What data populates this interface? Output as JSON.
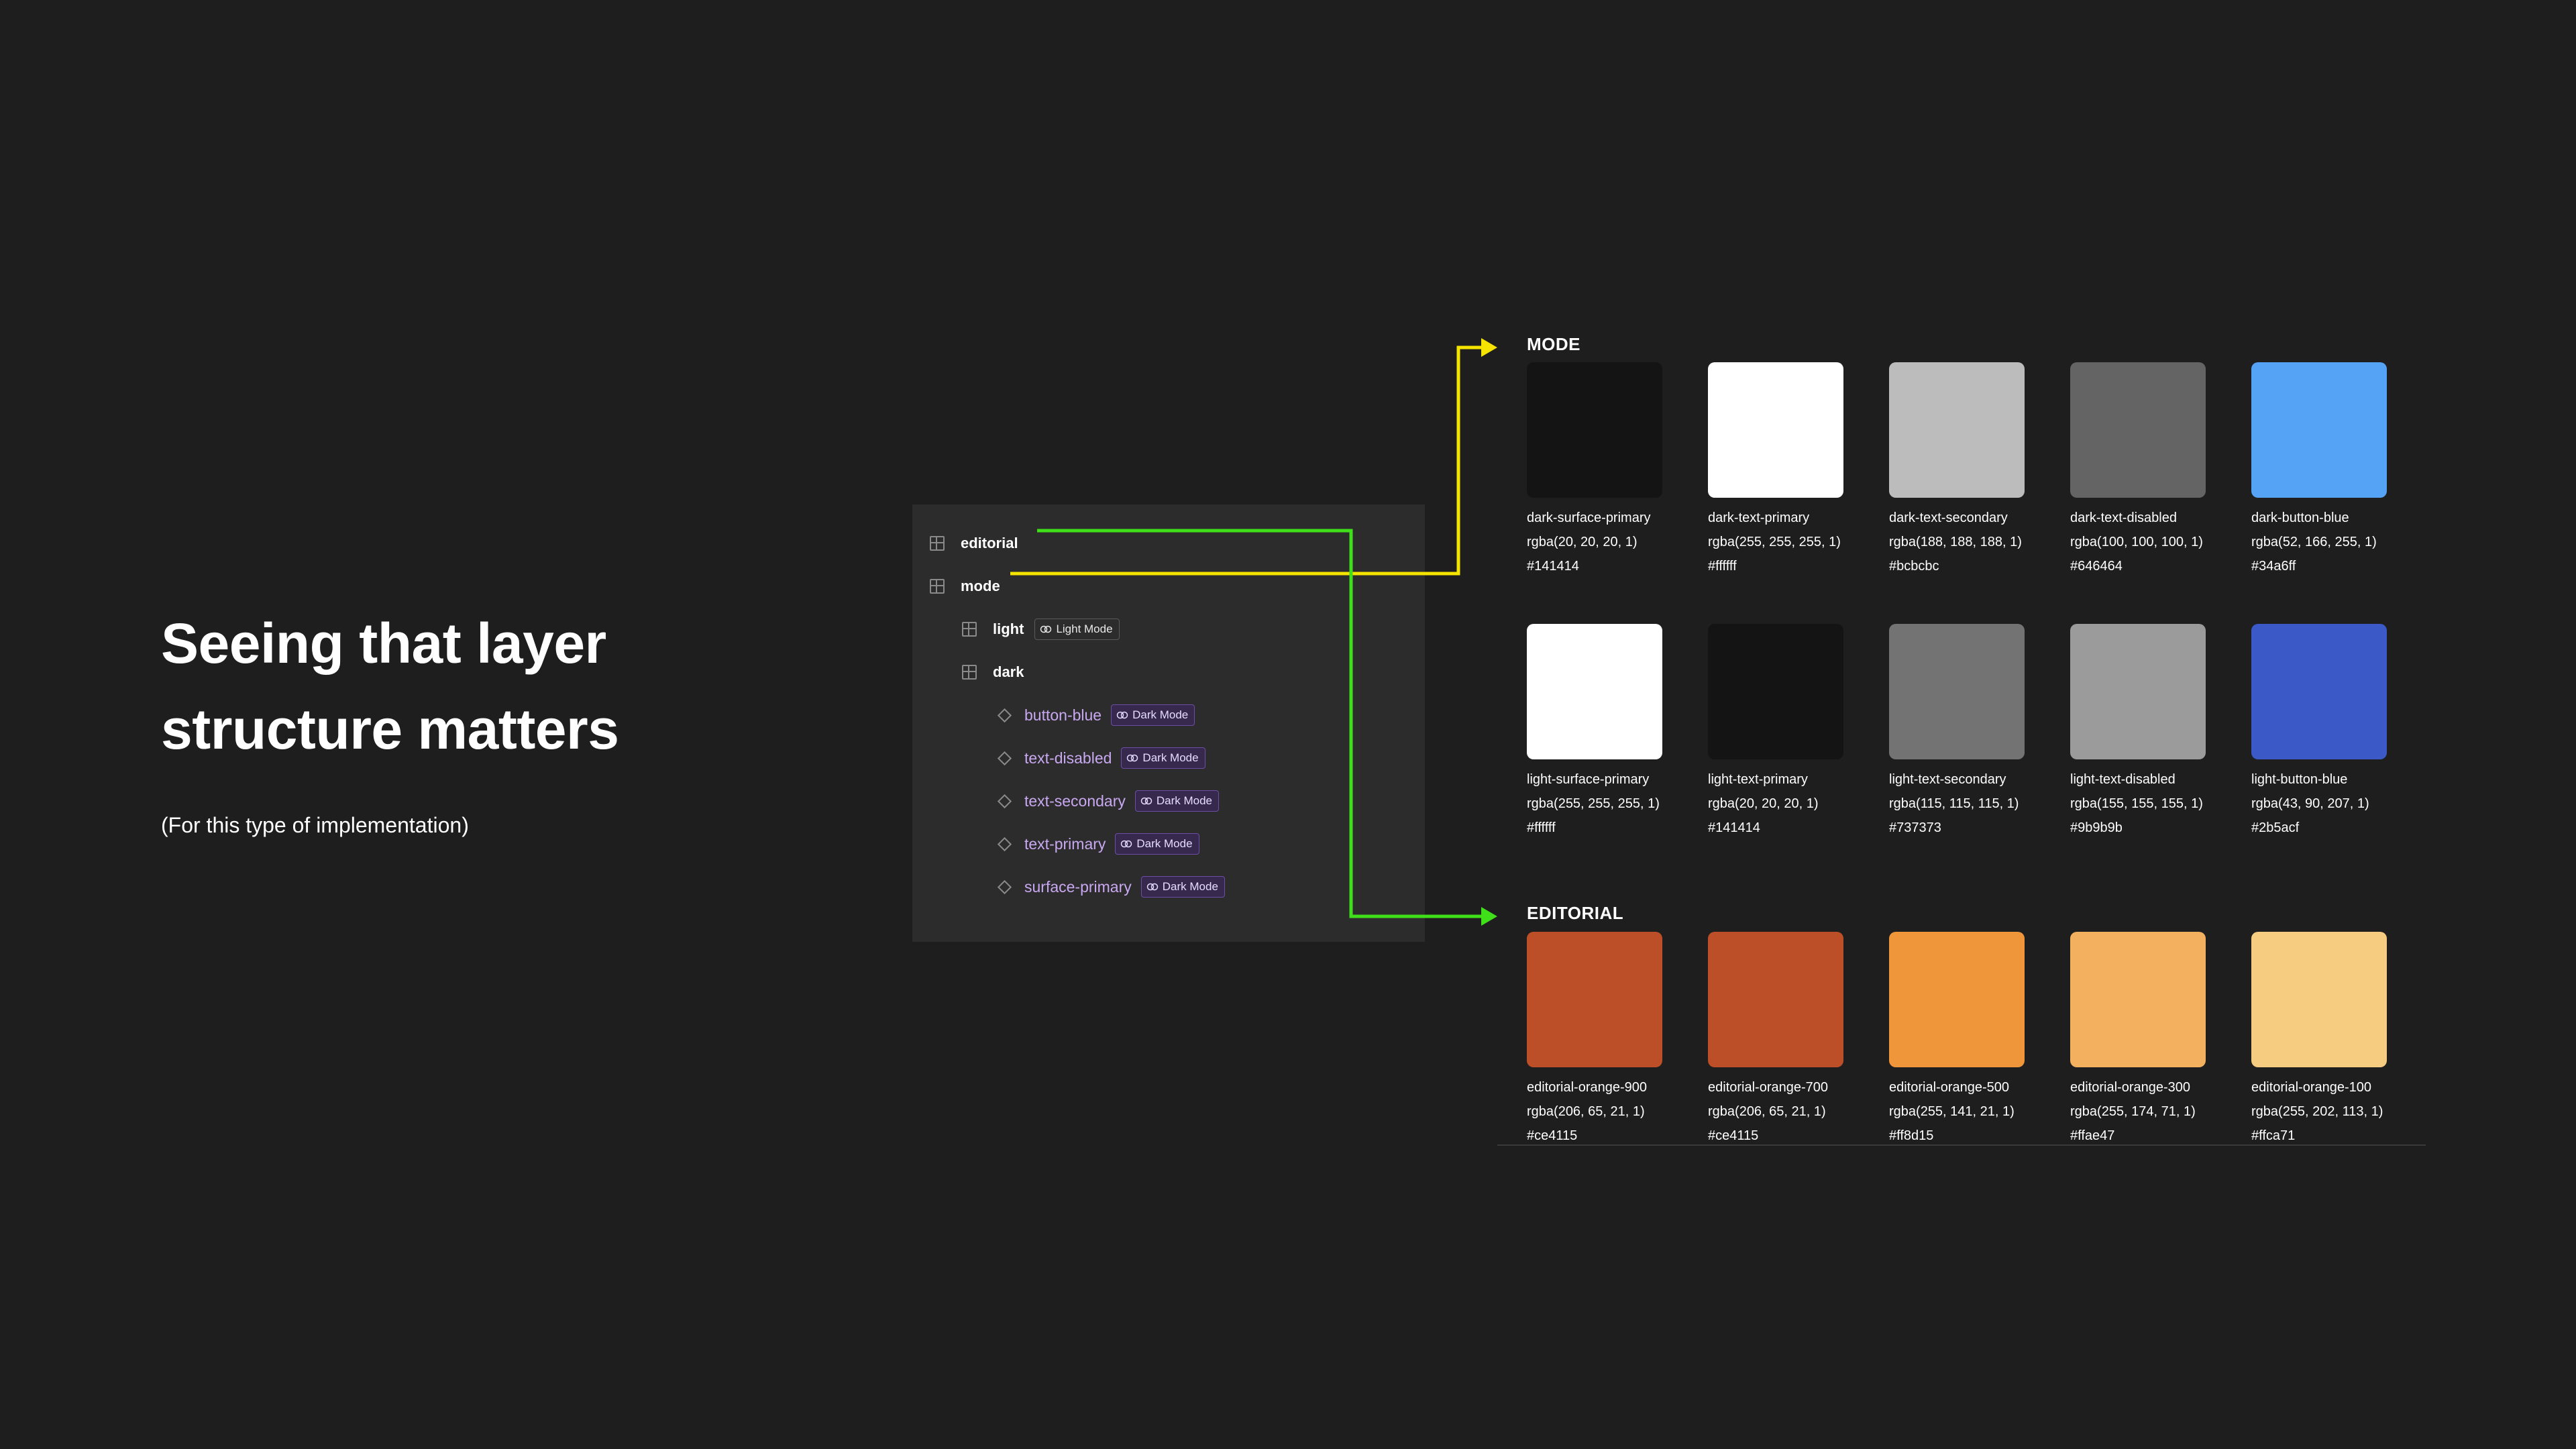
{
  "headline": {
    "line1": "Seeing that layer",
    "line2": "structure matters"
  },
  "subhead": "(For this type of implementation)",
  "layers": {
    "editorial": "editorial",
    "mode": "mode",
    "light": {
      "label": "light",
      "badge": "Light Mode"
    },
    "dark": "dark",
    "components": [
      {
        "label": "button-blue",
        "badge": "Dark Mode"
      },
      {
        "label": "text-disabled",
        "badge": "Dark Mode"
      },
      {
        "label": "text-secondary",
        "badge": "Dark Mode"
      },
      {
        "label": "text-primary",
        "badge": "Dark Mode"
      },
      {
        "label": "surface-primary",
        "badge": "Dark Mode"
      }
    ]
  },
  "connector_colors": {
    "mode": "#f5e400",
    "editorial": "#3fe01a"
  },
  "mode_section": {
    "title": "MODE",
    "dark": [
      {
        "name": "dark-surface-primary",
        "rgba": "rgba(20, 20, 20, 1)",
        "hex": "#141414",
        "color": "#141414"
      },
      {
        "name": "dark-text-primary",
        "rgba": "rgba(255, 255, 255, 1)",
        "hex": "#ffffff",
        "color": "#ffffff"
      },
      {
        "name": "dark-text-secondary",
        "rgba": "rgba(188, 188, 188, 1)",
        "hex": "#bcbcbc",
        "color": "#bcbcbc"
      },
      {
        "name": "dark-text-disabled",
        "rgba": "rgba(100, 100, 100, 1)",
        "hex": "#646464",
        "color": "#646464"
      },
      {
        "name": "dark-button-blue",
        "rgba": "rgba(52, 166, 255, 1)",
        "hex": "#34a6ff",
        "color": "#55a3f5"
      }
    ],
    "light": [
      {
        "name": "light-surface-primary",
        "rgba": "rgba(255, 255, 255, 1)",
        "hex": "#ffffff",
        "color": "#ffffff"
      },
      {
        "name": "light-text-primary",
        "rgba": "rgba(20, 20, 20, 1)",
        "hex": "#141414",
        "color": "#141414"
      },
      {
        "name": "light-text-secondary",
        "rgba": "rgba(115, 115, 115, 1)",
        "hex": "#737373",
        "color": "#737373"
      },
      {
        "name": "light-text-disabled",
        "rgba": "rgba(155, 155, 155, 1)",
        "hex": "#9b9b9b",
        "color": "#9b9b9b"
      },
      {
        "name": "light-button-blue",
        "rgba": "rgba(43, 90, 207, 1)",
        "hex": "#2b5acf",
        "color": "#3b5ac8"
      }
    ]
  },
  "editorial_section": {
    "title": "EDITORIAL",
    "swatches": [
      {
        "name": "editorial-orange-900",
        "rgba": "rgba(206, 65, 21, 1)",
        "hex": "#ce4115",
        "color": "#bc4e28"
      },
      {
        "name": "editorial-orange-700",
        "rgba": "rgba(206, 65, 21, 1)",
        "hex": "#ce4115",
        "color": "#bc4e28"
      },
      {
        "name": "editorial-orange-500",
        "rgba": "rgba(255, 141, 21, 1)",
        "hex": "#ff8d15",
        "color": "#ef963b"
      },
      {
        "name": "editorial-orange-300",
        "rgba": "rgba(255, 174, 71, 1)",
        "hex": "#ffae47",
        "color": "#f3b15f"
      },
      {
        "name": "editorial-orange-100",
        "rgba": "rgba(255, 202, 113, 1)",
        "hex": "#ffca71",
        "color": "#f6cd80"
      }
    ]
  }
}
